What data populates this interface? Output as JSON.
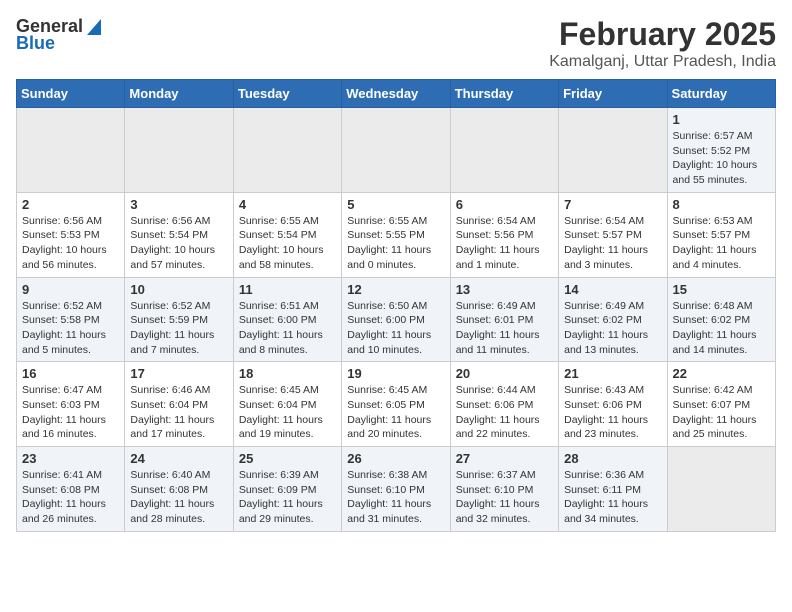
{
  "header": {
    "logo_general": "General",
    "logo_blue": "Blue",
    "title": "February 2025",
    "subtitle": "Kamalganj, Uttar Pradesh, India"
  },
  "weekdays": [
    "Sunday",
    "Monday",
    "Tuesday",
    "Wednesday",
    "Thursday",
    "Friday",
    "Saturday"
  ],
  "weeks": [
    [
      {
        "day": "",
        "info": ""
      },
      {
        "day": "",
        "info": ""
      },
      {
        "day": "",
        "info": ""
      },
      {
        "day": "",
        "info": ""
      },
      {
        "day": "",
        "info": ""
      },
      {
        "day": "",
        "info": ""
      },
      {
        "day": "1",
        "info": "Sunrise: 6:57 AM\nSunset: 5:52 PM\nDaylight: 10 hours\nand 55 minutes."
      }
    ],
    [
      {
        "day": "2",
        "info": "Sunrise: 6:56 AM\nSunset: 5:53 PM\nDaylight: 10 hours\nand 56 minutes."
      },
      {
        "day": "3",
        "info": "Sunrise: 6:56 AM\nSunset: 5:54 PM\nDaylight: 10 hours\nand 57 minutes."
      },
      {
        "day": "4",
        "info": "Sunrise: 6:55 AM\nSunset: 5:54 PM\nDaylight: 10 hours\nand 58 minutes."
      },
      {
        "day": "5",
        "info": "Sunrise: 6:55 AM\nSunset: 5:55 PM\nDaylight: 11 hours\nand 0 minutes."
      },
      {
        "day": "6",
        "info": "Sunrise: 6:54 AM\nSunset: 5:56 PM\nDaylight: 11 hours\nand 1 minute."
      },
      {
        "day": "7",
        "info": "Sunrise: 6:54 AM\nSunset: 5:57 PM\nDaylight: 11 hours\nand 3 minutes."
      },
      {
        "day": "8",
        "info": "Sunrise: 6:53 AM\nSunset: 5:57 PM\nDaylight: 11 hours\nand 4 minutes."
      }
    ],
    [
      {
        "day": "9",
        "info": "Sunrise: 6:52 AM\nSunset: 5:58 PM\nDaylight: 11 hours\nand 5 minutes."
      },
      {
        "day": "10",
        "info": "Sunrise: 6:52 AM\nSunset: 5:59 PM\nDaylight: 11 hours\nand 7 minutes."
      },
      {
        "day": "11",
        "info": "Sunrise: 6:51 AM\nSunset: 6:00 PM\nDaylight: 11 hours\nand 8 minutes."
      },
      {
        "day": "12",
        "info": "Sunrise: 6:50 AM\nSunset: 6:00 PM\nDaylight: 11 hours\nand 10 minutes."
      },
      {
        "day": "13",
        "info": "Sunrise: 6:49 AM\nSunset: 6:01 PM\nDaylight: 11 hours\nand 11 minutes."
      },
      {
        "day": "14",
        "info": "Sunrise: 6:49 AM\nSunset: 6:02 PM\nDaylight: 11 hours\nand 13 minutes."
      },
      {
        "day": "15",
        "info": "Sunrise: 6:48 AM\nSunset: 6:02 PM\nDaylight: 11 hours\nand 14 minutes."
      }
    ],
    [
      {
        "day": "16",
        "info": "Sunrise: 6:47 AM\nSunset: 6:03 PM\nDaylight: 11 hours\nand 16 minutes."
      },
      {
        "day": "17",
        "info": "Sunrise: 6:46 AM\nSunset: 6:04 PM\nDaylight: 11 hours\nand 17 minutes."
      },
      {
        "day": "18",
        "info": "Sunrise: 6:45 AM\nSunset: 6:04 PM\nDaylight: 11 hours\nand 19 minutes."
      },
      {
        "day": "19",
        "info": "Sunrise: 6:45 AM\nSunset: 6:05 PM\nDaylight: 11 hours\nand 20 minutes."
      },
      {
        "day": "20",
        "info": "Sunrise: 6:44 AM\nSunset: 6:06 PM\nDaylight: 11 hours\nand 22 minutes."
      },
      {
        "day": "21",
        "info": "Sunrise: 6:43 AM\nSunset: 6:06 PM\nDaylight: 11 hours\nand 23 minutes."
      },
      {
        "day": "22",
        "info": "Sunrise: 6:42 AM\nSunset: 6:07 PM\nDaylight: 11 hours\nand 25 minutes."
      }
    ],
    [
      {
        "day": "23",
        "info": "Sunrise: 6:41 AM\nSunset: 6:08 PM\nDaylight: 11 hours\nand 26 minutes."
      },
      {
        "day": "24",
        "info": "Sunrise: 6:40 AM\nSunset: 6:08 PM\nDaylight: 11 hours\nand 28 minutes."
      },
      {
        "day": "25",
        "info": "Sunrise: 6:39 AM\nSunset: 6:09 PM\nDaylight: 11 hours\nand 29 minutes."
      },
      {
        "day": "26",
        "info": "Sunrise: 6:38 AM\nSunset: 6:10 PM\nDaylight: 11 hours\nand 31 minutes."
      },
      {
        "day": "27",
        "info": "Sunrise: 6:37 AM\nSunset: 6:10 PM\nDaylight: 11 hours\nand 32 minutes."
      },
      {
        "day": "28",
        "info": "Sunrise: 6:36 AM\nSunset: 6:11 PM\nDaylight: 11 hours\nand 34 minutes."
      },
      {
        "day": "",
        "info": ""
      }
    ]
  ]
}
